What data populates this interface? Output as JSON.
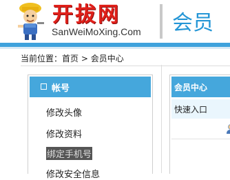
{
  "site": {
    "logo_cn": "开拔网",
    "logo_en": "SanWeiMoXing.Com",
    "header_title": "会员"
  },
  "breadcrumb": {
    "prefix": "当前位置：",
    "home": "首页",
    "separator": ">",
    "current": "会员中心"
  },
  "sidebar": {
    "title": "帐号",
    "items": [
      {
        "label": "修改头像",
        "active": false
      },
      {
        "label": "修改资料",
        "active": false
      },
      {
        "label": "绑定手机号",
        "active": true
      },
      {
        "label": "修改安全信息",
        "active": false
      }
    ]
  },
  "panel": {
    "title": "会员中心",
    "subtitle": "快速入口"
  },
  "colors": {
    "accent": "#45a7dc",
    "logo_red": "#e0201a",
    "header_title": "#2496d6"
  }
}
